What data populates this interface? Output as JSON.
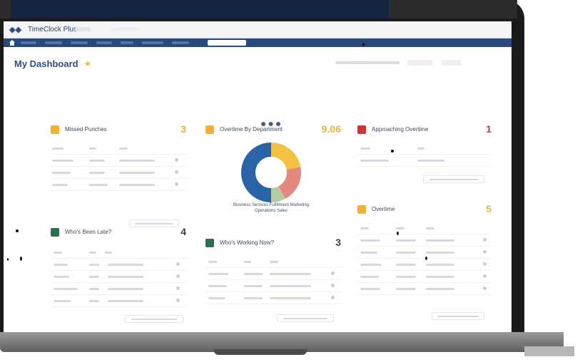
{
  "app": {
    "name": "TimeClock Plus"
  },
  "page": {
    "title": "My Dashboard",
    "title_star": "★",
    "loading": "●●●"
  },
  "widgets": {
    "missed_punches": {
      "title": "Missed Punches",
      "count": "3",
      "color": "#f2b134",
      "rows": 4
    },
    "overtime_by_department": {
      "title": "Overtime By Department",
      "count": "9.06",
      "color": "#f2b134",
      "caption_line1": "Business Services Fulfillment Marketing",
      "caption_line2": "Operations Sales",
      "segments": [
        {
          "color": "#2a64a7",
          "value": 50
        },
        {
          "color": "#f4c242",
          "value": 22
        },
        {
          "color": "#e4897c",
          "value": 20
        },
        {
          "color": "#b7c9a0",
          "value": 8
        }
      ]
    },
    "approaching_overtime": {
      "title": "Approaching Overtime",
      "count": "1",
      "color": "#d03535"
    },
    "whos_been_late": {
      "title": "Who's Been Late?",
      "count": "4",
      "color": "#2e6e4e",
      "rows": 5
    },
    "whos_working_now": {
      "title": "Who's Working Now?",
      "count": "3",
      "color": "#2e6e4e",
      "rows": 4
    },
    "overtime": {
      "title": "Overtime",
      "count": "5",
      "color": "#f2b134",
      "rows": 6
    }
  }
}
